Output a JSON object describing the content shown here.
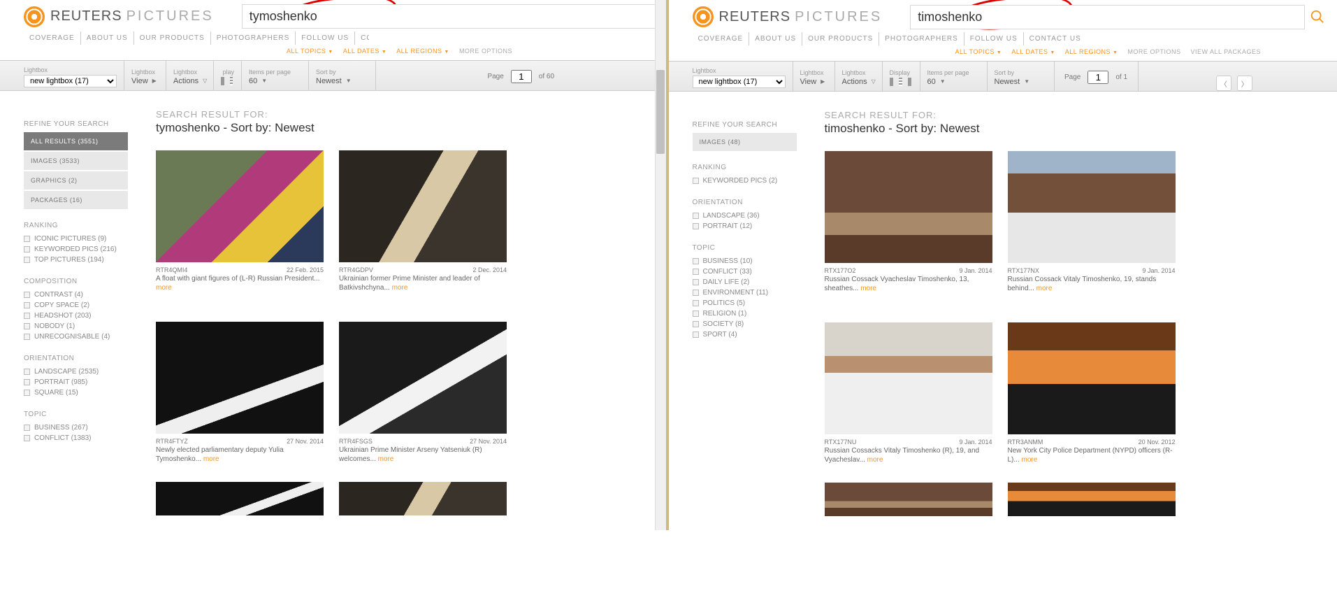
{
  "brand": {
    "a": "REUTERS",
    "b": "PICTURES"
  },
  "nav": {
    "coverage": "COVERAGE",
    "about": "ABOUT US",
    "products": "OUR PRODUCTS",
    "photographers": "PHOTOGRAPHERS",
    "follow": "FOLLOW US",
    "contact": "CONTACT US"
  },
  "filters": {
    "topics": "ALL TOPICS",
    "dates": "ALL DATES",
    "regions": "ALL REGIONS",
    "more": "MORE OPTIONS",
    "viewall": "VIEW ALL PACKAGES"
  },
  "toolbar": {
    "lightbox_lbl": "Lightbox",
    "lightbox_val": "new lightbox (17)",
    "view_lbl": "Lightbox",
    "view_val": "View",
    "actions_lbl": "Lightbox",
    "actions_val": "Actions",
    "display_lbl": "Display",
    "ipp_lbl": "Items per page",
    "ipp_val": "60",
    "sort_lbl": "Sort by",
    "sort_val": "Newest",
    "page_lbl": "Page"
  },
  "left": {
    "search": "tymoshenko",
    "page_val": "1",
    "page_of": "of 60",
    "refine": "REFINE YOUR SEARCH",
    "facets": [
      {
        "label": "ALL RESULTS (3551)",
        "active": true
      },
      {
        "label": "IMAGES (3533)",
        "active": false
      },
      {
        "label": "GRAPHICS (2)",
        "active": false
      },
      {
        "label": "PACKAGES (16)",
        "active": false
      }
    ],
    "ranking_h": "RANKING",
    "ranking": [
      "ICONIC PICTURES (9)",
      "KEYWORDED PICS (216)",
      "TOP PICTURES (194)"
    ],
    "comp_h": "COMPOSITION",
    "comp": [
      "CONTRAST (4)",
      "COPY SPACE (2)",
      "HEADSHOT (203)",
      "NOBODY (1)",
      "UNRECOGNISABLE (4)"
    ],
    "orient_h": "ORIENTATION",
    "orient": [
      "LANDSCAPE (2535)",
      "PORTRAIT (985)",
      "SQUARE (15)"
    ],
    "topic_h": "TOPIC",
    "topic": [
      "BUSINESS (267)",
      "CONFLICT (1383)"
    ],
    "res_h1": "SEARCH RESULT FOR:",
    "res_h2": "tymoshenko - Sort by: Newest",
    "cards": [
      {
        "id": "RTR4QMI4",
        "date": "22 Feb. 2015",
        "cap": "A float with giant figures of (L-R) Russian President...",
        "more": "more",
        "cls": "img-carnival"
      },
      {
        "id": "RTR4GDPV",
        "date": "2 Dec. 2014",
        "cap": "Ukrainian former Prime Minister and leader of Batkivshchyna...",
        "more": "more",
        "cls": "img-kiss"
      },
      {
        "id": "RTR4FTYZ",
        "date": "27 Nov. 2014",
        "cap": "Newly elected parliamentary deputy Yulia Tymoshenko...",
        "more": "more",
        "cls": "img-parl1"
      },
      {
        "id": "RTR4FSGS",
        "date": "27 Nov. 2014",
        "cap": "Ukrainian Prime Minister Arseny Yatseniuk (R) welcomes...",
        "more": "more",
        "cls": "img-parl2"
      }
    ]
  },
  "right": {
    "search": "timoshenko",
    "page_val": "1",
    "page_of": "of 1",
    "refine": "REFINE YOUR SEARCH",
    "facets": [
      {
        "label": "IMAGES (48)",
        "active": false
      }
    ],
    "ranking_h": "RANKING",
    "ranking": [
      "KEYWORDED PICS (2)"
    ],
    "orient_h": "ORIENTATION",
    "orient": [
      "LANDSCAPE (36)",
      "PORTRAIT (12)"
    ],
    "topic_h": "TOPIC",
    "topic": [
      "BUSINESS (10)",
      "CONFLICT (33)",
      "DAILY LIFE (2)",
      "ENVIRONMENT (11)",
      "POLITICS (5)",
      "RELIGION (1)",
      "SOCIETY (8)",
      "SPORT (4)"
    ],
    "res_h1": "SEARCH RESULT FOR:",
    "res_h2": "timoshenko - Sort by: Newest",
    "cards": [
      {
        "id": "RTX177O2",
        "date": "9 Jan. 2014",
        "cap": "Russian Cossack Vyacheslav Timoshenko, 13, sheathes...",
        "more": "more",
        "cls": "img-room"
      },
      {
        "id": "RTX177NX",
        "date": "9 Jan. 2014",
        "cap": "Russian Cossack Vitaly Timoshenko, 19, stands behind...",
        "more": "more",
        "cls": "img-sword"
      },
      {
        "id": "RTX177NU",
        "date": "9 Jan. 2014",
        "cap": "Russian Cossacks Vitaly Timoshenko (R), 19, and Vyacheslav...",
        "more": "more",
        "cls": "img-snow1"
      },
      {
        "id": "RTR3ANMM",
        "date": "20 Nov. 2012",
        "cap": "New York City Police Department (NYPD) officers (R-L)...",
        "more": "more",
        "cls": "img-sunset"
      }
    ]
  }
}
